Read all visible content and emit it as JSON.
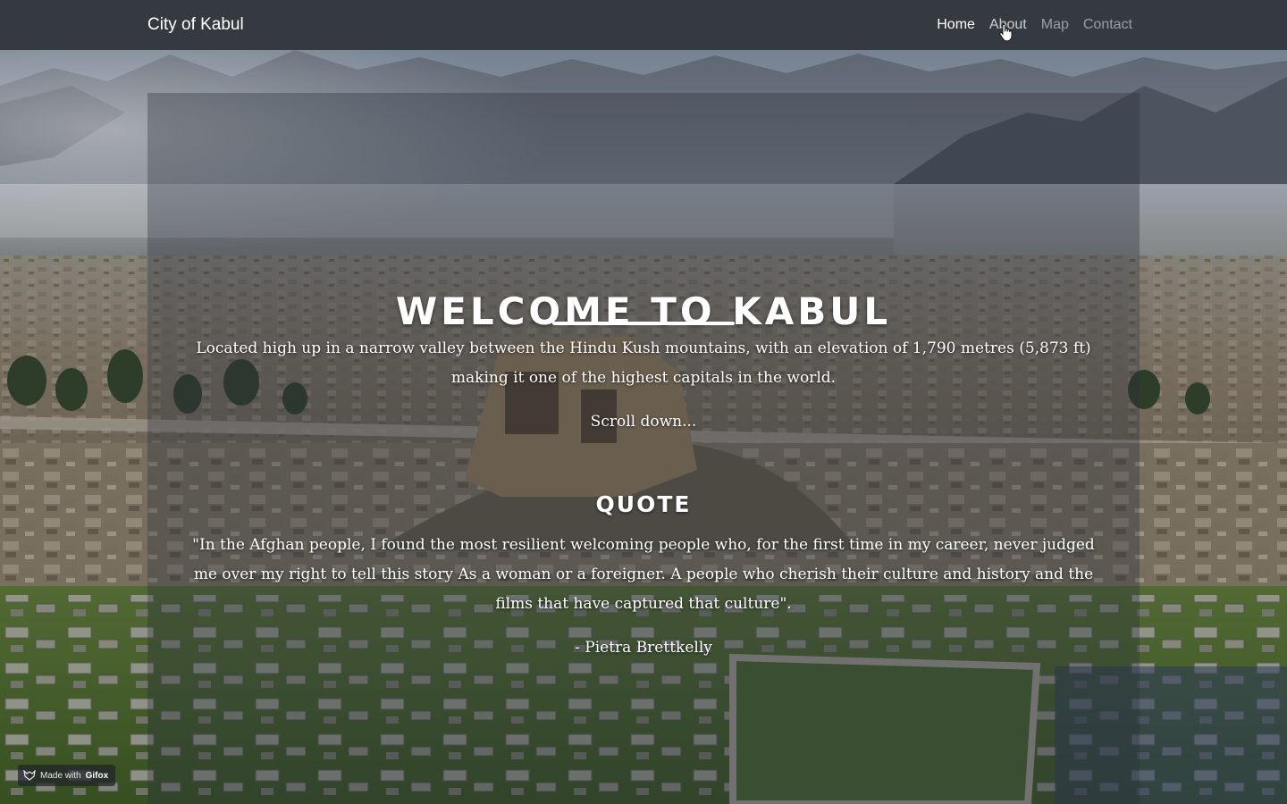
{
  "navbar": {
    "brand": "City of Kabul",
    "links": [
      {
        "label": "Home",
        "state": "active"
      },
      {
        "label": "About",
        "state": "hover"
      },
      {
        "label": "Map",
        "state": "inactive"
      },
      {
        "label": "Contact",
        "state": "inactive"
      }
    ]
  },
  "hero": {
    "title": "WELCOME TO KABUL",
    "intro": "Located high up in a narrow valley between the Hindu Kush mountains, with an elevation of 1,790 metres (5,873 ft) making it one of the highest capitals in the world.",
    "scroll_hint": "Scroll down...",
    "background_image": "panorama-of-kabul-with-mountains"
  },
  "quote": {
    "heading": "QUOTE",
    "text": "\"In the Afghan people, I found the most resilient welcoming people who, for the first time in my career, never judged me over my right to tell this story As a woman or a foreigner. A people who cherish their culture and history and the films that have captured that culture\".",
    "author": "- Pietra Brettkelly"
  },
  "watermark": {
    "prefix": "Made with",
    "brand": "Gifox"
  },
  "colors": {
    "navbar_bg": "#343a40",
    "nav_active": "#ffffff",
    "nav_inactive": "rgba(255,255,255,0.5)",
    "text": "#ffffff"
  }
}
